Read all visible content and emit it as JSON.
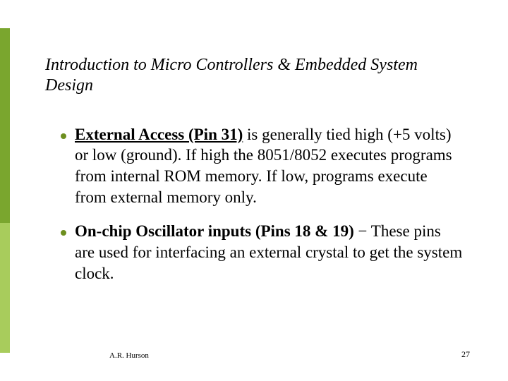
{
  "slide": {
    "title": "Introduction to Micro Controllers & Embedded System Design",
    "bullets": [
      {
        "lead": "External Access (Pin 31)",
        "rest": " is generally tied high (+5 volts) or low (ground).  If high the 8051/8052 executes programs from internal ROM memory. If low, programs execute from external memory only."
      },
      {
        "lead": "On-chip Oscillator inputs (Pins 18 & 19)",
        "rest": " − These pins are used for interfacing an external crystal to get the system clock."
      }
    ],
    "footer": {
      "author": "A.R. Hurson",
      "page": "27"
    }
  }
}
